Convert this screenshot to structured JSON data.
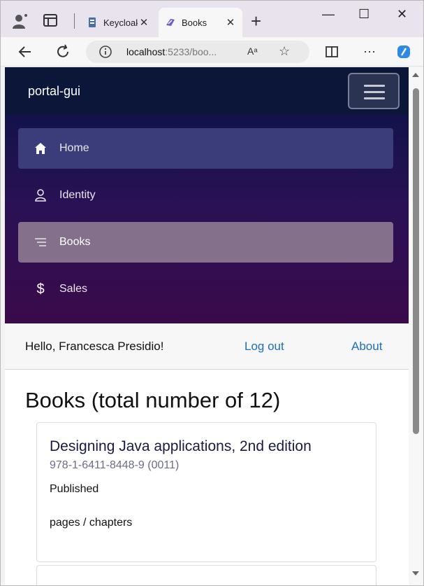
{
  "browser": {
    "tabs": [
      {
        "label": "Keycloak",
        "icon": "keycloak-icon",
        "active": false
      },
      {
        "label": "Books",
        "icon": "blazor-icon",
        "active": true
      }
    ],
    "address": {
      "host": "localhost",
      "rest": ":5233/boo...",
      "placeholder": ""
    },
    "readaloud_label": "Aᵃ",
    "window_controls": {
      "minimize": "—",
      "maximize": "☐",
      "close": "✕"
    }
  },
  "app": {
    "brand": "portal-gui",
    "nav": [
      {
        "label": "Home",
        "icon": "home-icon"
      },
      {
        "label": "Identity",
        "icon": "person-icon"
      },
      {
        "label": "Books",
        "icon": "list-icon"
      },
      {
        "label": "Sales",
        "icon": "dollar-icon"
      }
    ],
    "userbar": {
      "hello": "Hello, Francesca Presidio!",
      "logout": "Log out",
      "about": "About"
    },
    "heading": "Books (total number of 12)",
    "books": [
      {
        "title": "Designing Java applications, 2nd edition",
        "isbn": "978-1-6411-8448-9 (0011)",
        "status": "Published",
        "pages": "pages / chapters"
      }
    ]
  },
  "colors": {
    "topbar": "#0b1638",
    "nav_active": "#84708a",
    "nav_home": "#3b3d7a",
    "link": "#1b6ec2"
  }
}
